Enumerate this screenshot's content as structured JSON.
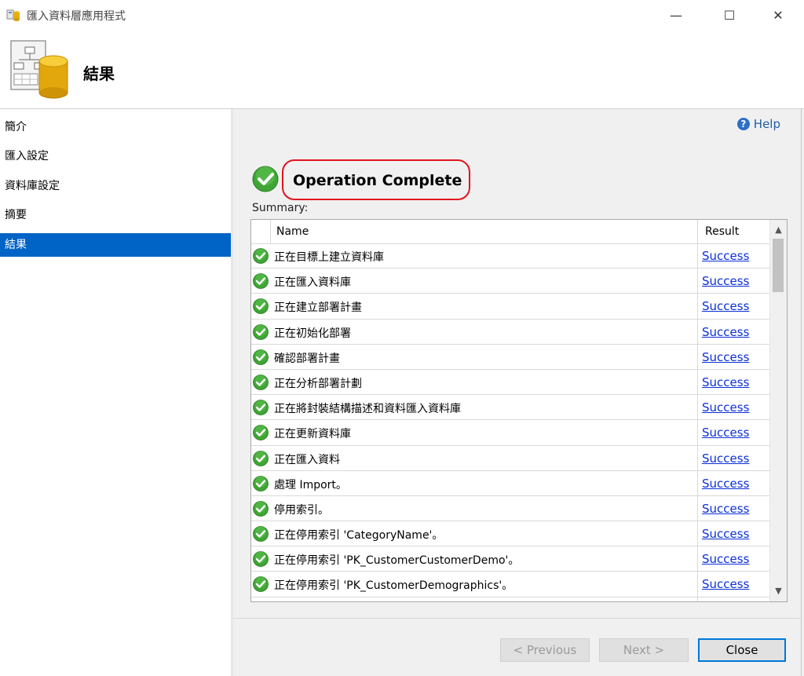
{
  "window": {
    "title": "匯入資料層應用程式",
    "minimize_glyph": "—",
    "maximize_glyph": "☐",
    "close_glyph": "✕"
  },
  "header": {
    "heading": "結果"
  },
  "nav": {
    "items": [
      {
        "label": "簡介",
        "active": false
      },
      {
        "label": "匯入設定",
        "active": false
      },
      {
        "label": "資料庫設定",
        "active": false
      },
      {
        "label": "摘要",
        "active": false
      },
      {
        "label": "結果",
        "active": true
      }
    ]
  },
  "main": {
    "help_label": "Help",
    "status_title": "Operation Complete",
    "summary_label": "Summary:",
    "table": {
      "col_name": "Name",
      "col_result": "Result",
      "rows": [
        {
          "name": "正在目標上建立資料庫",
          "result": "Success"
        },
        {
          "name": "正在匯入資料庫",
          "result": "Success"
        },
        {
          "name": "正在建立部署計畫",
          "result": "Success"
        },
        {
          "name": "正在初始化部署",
          "result": "Success"
        },
        {
          "name": "確認部署計畫",
          "result": "Success"
        },
        {
          "name": "正在分析部署計劃",
          "result": "Success"
        },
        {
          "name": "正在將封裝結構描述和資料匯入資料庫",
          "result": "Success"
        },
        {
          "name": "正在更新資料庫",
          "result": "Success"
        },
        {
          "name": "正在匯入資料",
          "result": "Success"
        },
        {
          "name": "處理 Import。",
          "result": "Success"
        },
        {
          "name": "停用索引。",
          "result": "Success"
        },
        {
          "name": "正在停用索引 'CategoryName'。",
          "result": "Success"
        },
        {
          "name": "正在停用索引 'PK_CustomerCustomerDemo'。",
          "result": "Success"
        },
        {
          "name": "正在停用索引 'PK_CustomerDemographics'。",
          "result": "Success"
        }
      ]
    }
  },
  "buttons": {
    "previous": "< Previous",
    "next": "Next >",
    "close": "Close"
  },
  "colors": {
    "accent": "#0063c6",
    "success_green": "#3fa535",
    "link_blue": "#0b2fd8",
    "highlight_red": "#e0141e"
  }
}
